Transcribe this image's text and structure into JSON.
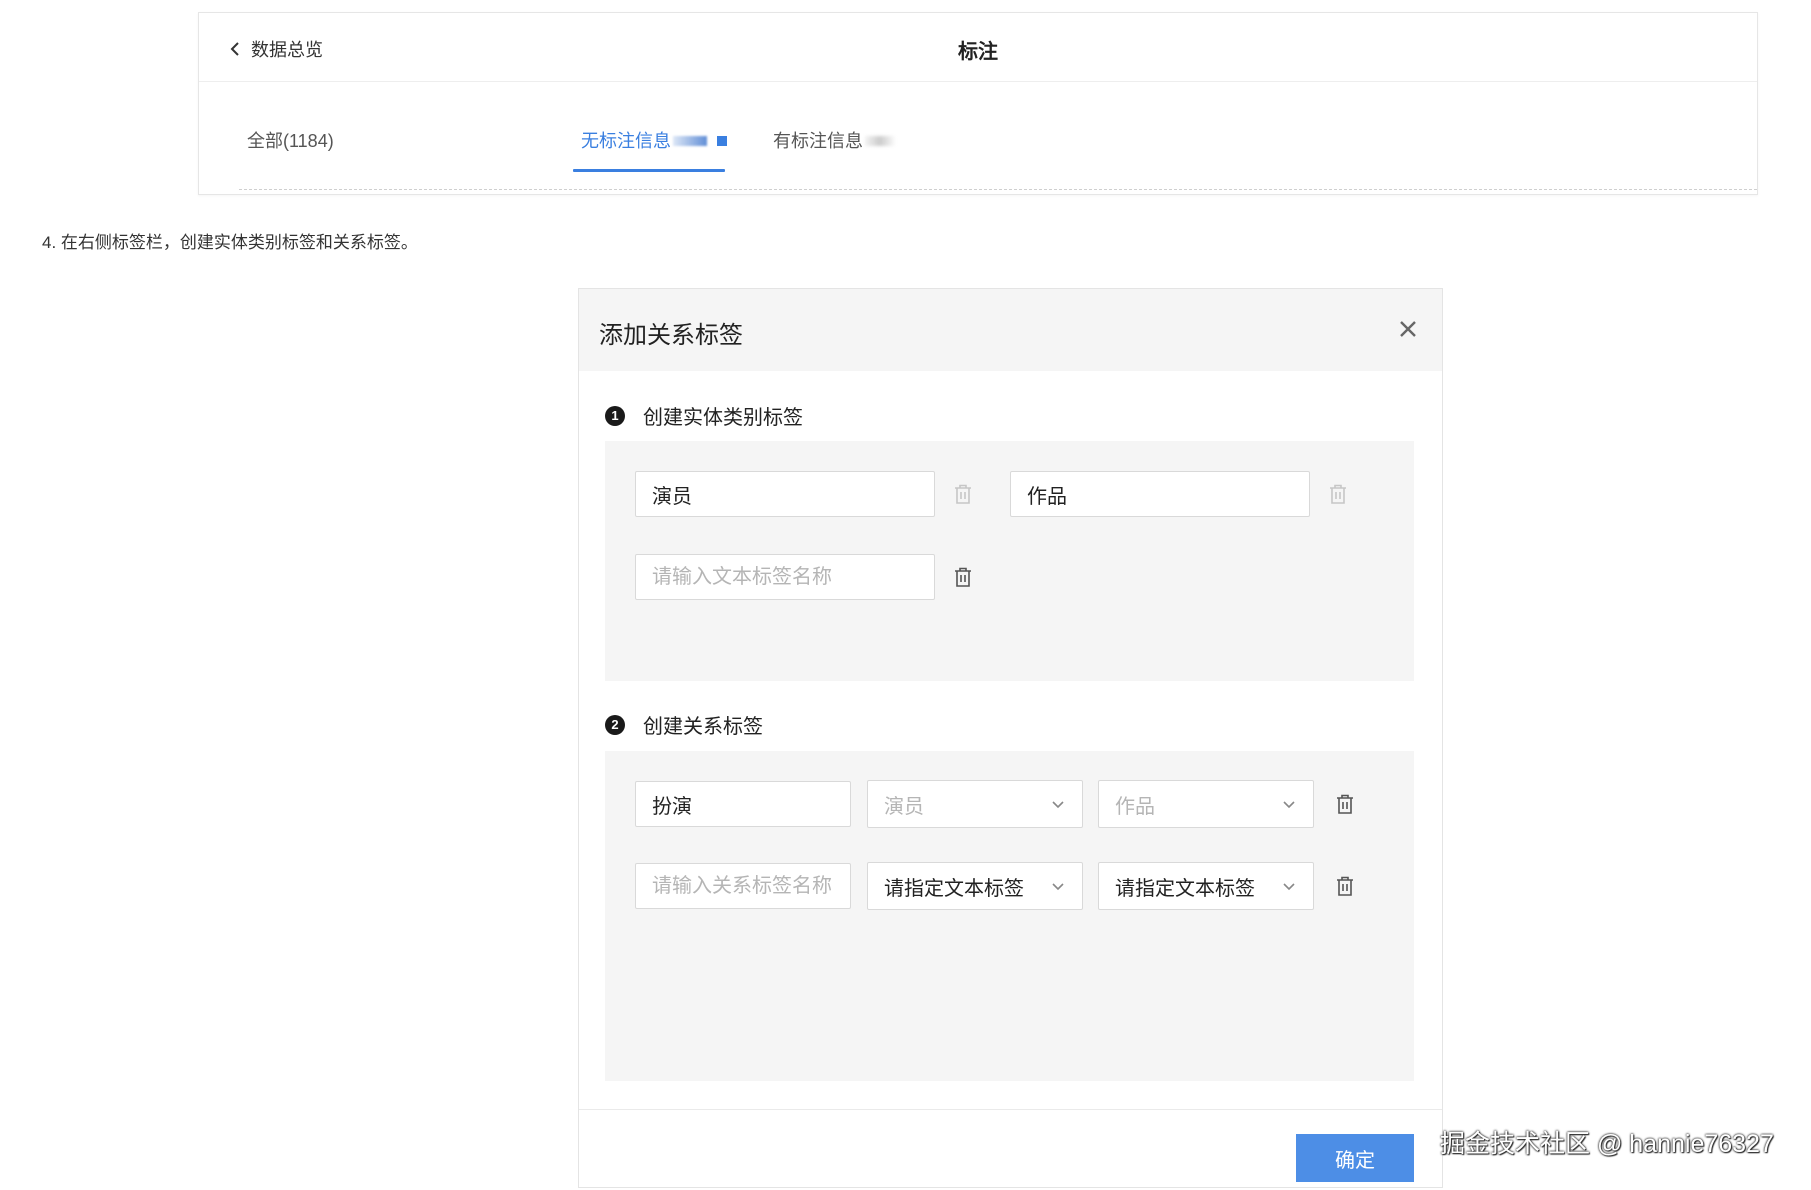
{
  "top_panel": {
    "back_label": "数据总览",
    "title": "标注",
    "tabs": [
      {
        "label": "全部(1184)"
      },
      {
        "label": "无标注信息"
      },
      {
        "label": "有标注信息"
      }
    ]
  },
  "instruction": "4. 在右侧标签栏，创建实体类别标签和关系标签。",
  "dialog": {
    "title": "添加关系标签",
    "section1": {
      "number": "1",
      "label": "创建实体类别标签",
      "entities": [
        {
          "value": "演员"
        },
        {
          "value": "作品"
        }
      ],
      "new_placeholder": "请输入文本标签名称"
    },
    "section2": {
      "number": "2",
      "label": "创建关系标签",
      "relation_value": "扮演",
      "relation_from": "演员",
      "relation_to": "作品",
      "new_placeholder": "请输入关系标签名称",
      "select_placeholder": "请指定文本标签"
    },
    "confirm_label": "确定"
  },
  "watermark": "掘金技术社区 @ hannie76327",
  "colors": {
    "accent": "#3a7fe0",
    "confirm": "#4d8ee6",
    "panel_gray": "#f5f5f5"
  },
  "icons": [
    "chevron-left-icon",
    "close-icon",
    "trash-icon",
    "chevron-down-icon"
  ]
}
